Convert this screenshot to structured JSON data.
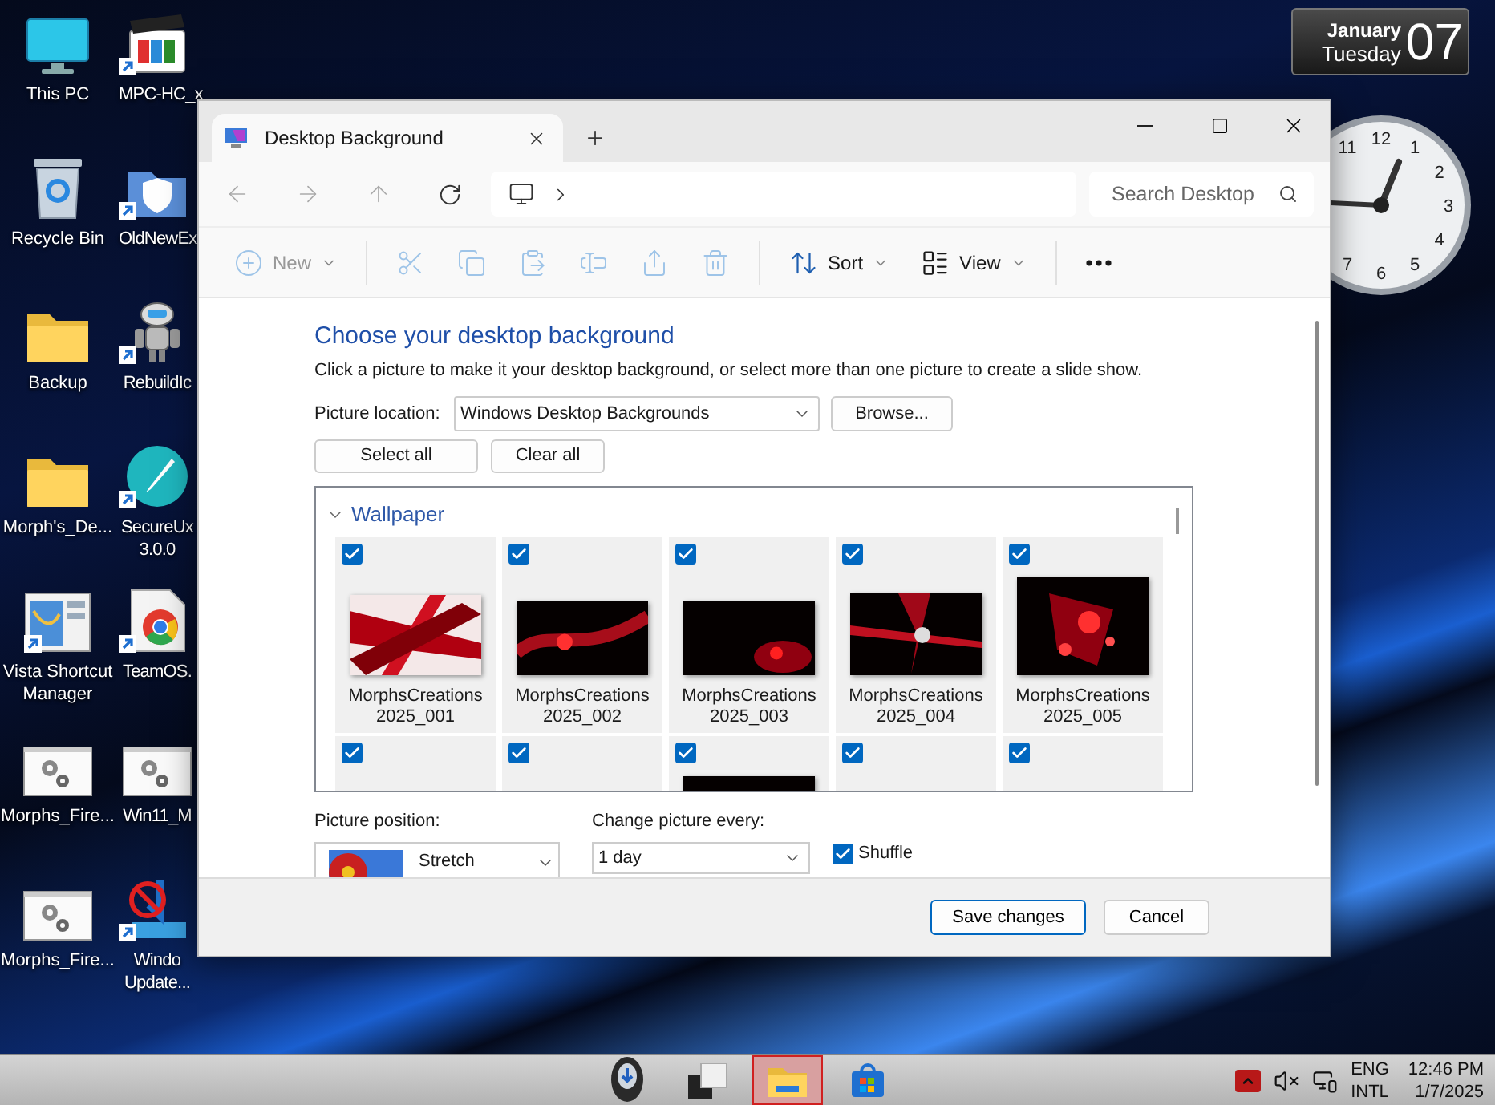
{
  "desktop": {
    "icons": [
      {
        "lines": [
          "This PC"
        ],
        "kind": "monitor",
        "shortcut": false
      },
      {
        "lines": [
          "MPC-HC_x"
        ],
        "kind": "media",
        "shortcut": true
      },
      {
        "lines": [
          "Recycle Bin"
        ],
        "kind": "recycle",
        "shortcut": false
      },
      {
        "lines": [
          "OldNewEx"
        ],
        "kind": "shield",
        "shortcut": true
      },
      {
        "lines": [
          "Backup"
        ],
        "kind": "folder",
        "shortcut": false
      },
      {
        "lines": [
          "RebuildIc"
        ],
        "kind": "robot",
        "shortcut": true
      },
      {
        "lines": [
          "Morph's_De..."
        ],
        "kind": "folder",
        "shortcut": false
      },
      {
        "lines": [
          "SecureUx",
          "3.0.0"
        ],
        "kind": "brush",
        "shortcut": true
      },
      {
        "lines": [
          "Vista Shortcut",
          "Manager"
        ],
        "kind": "app",
        "shortcut": true
      },
      {
        "lines": [
          "TeamOS."
        ],
        "kind": "browser",
        "shortcut": true
      },
      {
        "lines": [
          "Morphs_Fire..."
        ],
        "kind": "gears",
        "shortcut": false
      },
      {
        "lines": [
          "Win11_M"
        ],
        "kind": "gears",
        "shortcut": false
      },
      {
        "lines": [
          "Morphs_Fire..."
        ],
        "kind": "gears",
        "shortcut": false
      },
      {
        "lines": [
          "Windo",
          "Update..."
        ],
        "kind": "blocked",
        "shortcut": true
      }
    ]
  },
  "calendar": {
    "month": "January",
    "weekday": "Tuesday",
    "day": "07"
  },
  "clock": {
    "numbers": [
      "11",
      "12",
      "1",
      "2",
      "3",
      "4",
      "7",
      "6",
      "5"
    ]
  },
  "window": {
    "tab": {
      "title": "Desktop Background",
      "selected": true
    },
    "search": {
      "placeholder": "Search Desktop"
    },
    "toolbar": [
      {
        "kind": "new",
        "label": "New",
        "disabled": true
      },
      {
        "kind": "cut",
        "disabled": true
      },
      {
        "kind": "copy",
        "disabled": true
      },
      {
        "kind": "paste",
        "disabled": true
      },
      {
        "kind": "rename",
        "disabled": true
      },
      {
        "kind": "share",
        "disabled": true
      },
      {
        "kind": "delete",
        "disabled": true
      },
      {
        "kind": "sort",
        "label": "Sort",
        "disabled": false
      },
      {
        "kind": "view",
        "label": "View",
        "disabled": false
      },
      {
        "kind": "more",
        "disabled": false
      }
    ],
    "page": {
      "heading": "Choose your desktop background",
      "description": "Click a picture to make it your desktop background, or select more than one picture to create a slide show.",
      "location": {
        "label": "Picture location:",
        "value": "Windows Desktop Backgrounds"
      },
      "browse": "Browse...",
      "select_all": "Select all",
      "clear_all": "Clear all",
      "group": {
        "title": "Wallpaper",
        "expanded": true,
        "items": [
          {
            "lines": [
              "MorphsCreations",
              "2025_001"
            ],
            "checked": true,
            "thumbnail": true
          },
          {
            "lines": [
              "MorphsCreations",
              "2025_002"
            ],
            "checked": true,
            "thumbnail": true
          },
          {
            "lines": [
              "MorphsCreations",
              "2025_003"
            ],
            "checked": true,
            "thumbnail": true
          },
          {
            "lines": [
              "MorphsCreations",
              "2025_004"
            ],
            "checked": true,
            "thumbnail": true
          },
          {
            "lines": [
              "MorphsCreations",
              "2025_005"
            ],
            "checked": true,
            "thumbnail": true
          },
          {
            "checked": true,
            "thumbnail": false
          },
          {
            "checked": true,
            "thumbnail": false
          },
          {
            "checked": true,
            "thumbnail": true
          },
          {
            "checked": true,
            "thumbnail": false
          },
          {
            "checked": true,
            "thumbnail": false
          }
        ]
      },
      "position": {
        "label": "Picture position:",
        "value": "Stretch"
      },
      "interval": {
        "label": "Change picture every:",
        "value": "1 day"
      },
      "shuffle": {
        "label": "Shuffle",
        "checked": true
      }
    },
    "footer": {
      "save": "Save changes",
      "cancel": "Cancel"
    }
  },
  "taskbar": {
    "apps": [
      {
        "kind": "start",
        "selected": false
      },
      {
        "kind": "taskview",
        "selected": false
      },
      {
        "kind": "explorer",
        "selected": true
      },
      {
        "kind": "store",
        "selected": false
      }
    ],
    "tray": {
      "language": "ENG",
      "layout": "INTL",
      "time": "12:46 PM",
      "date": "1/7/2025"
    }
  }
}
